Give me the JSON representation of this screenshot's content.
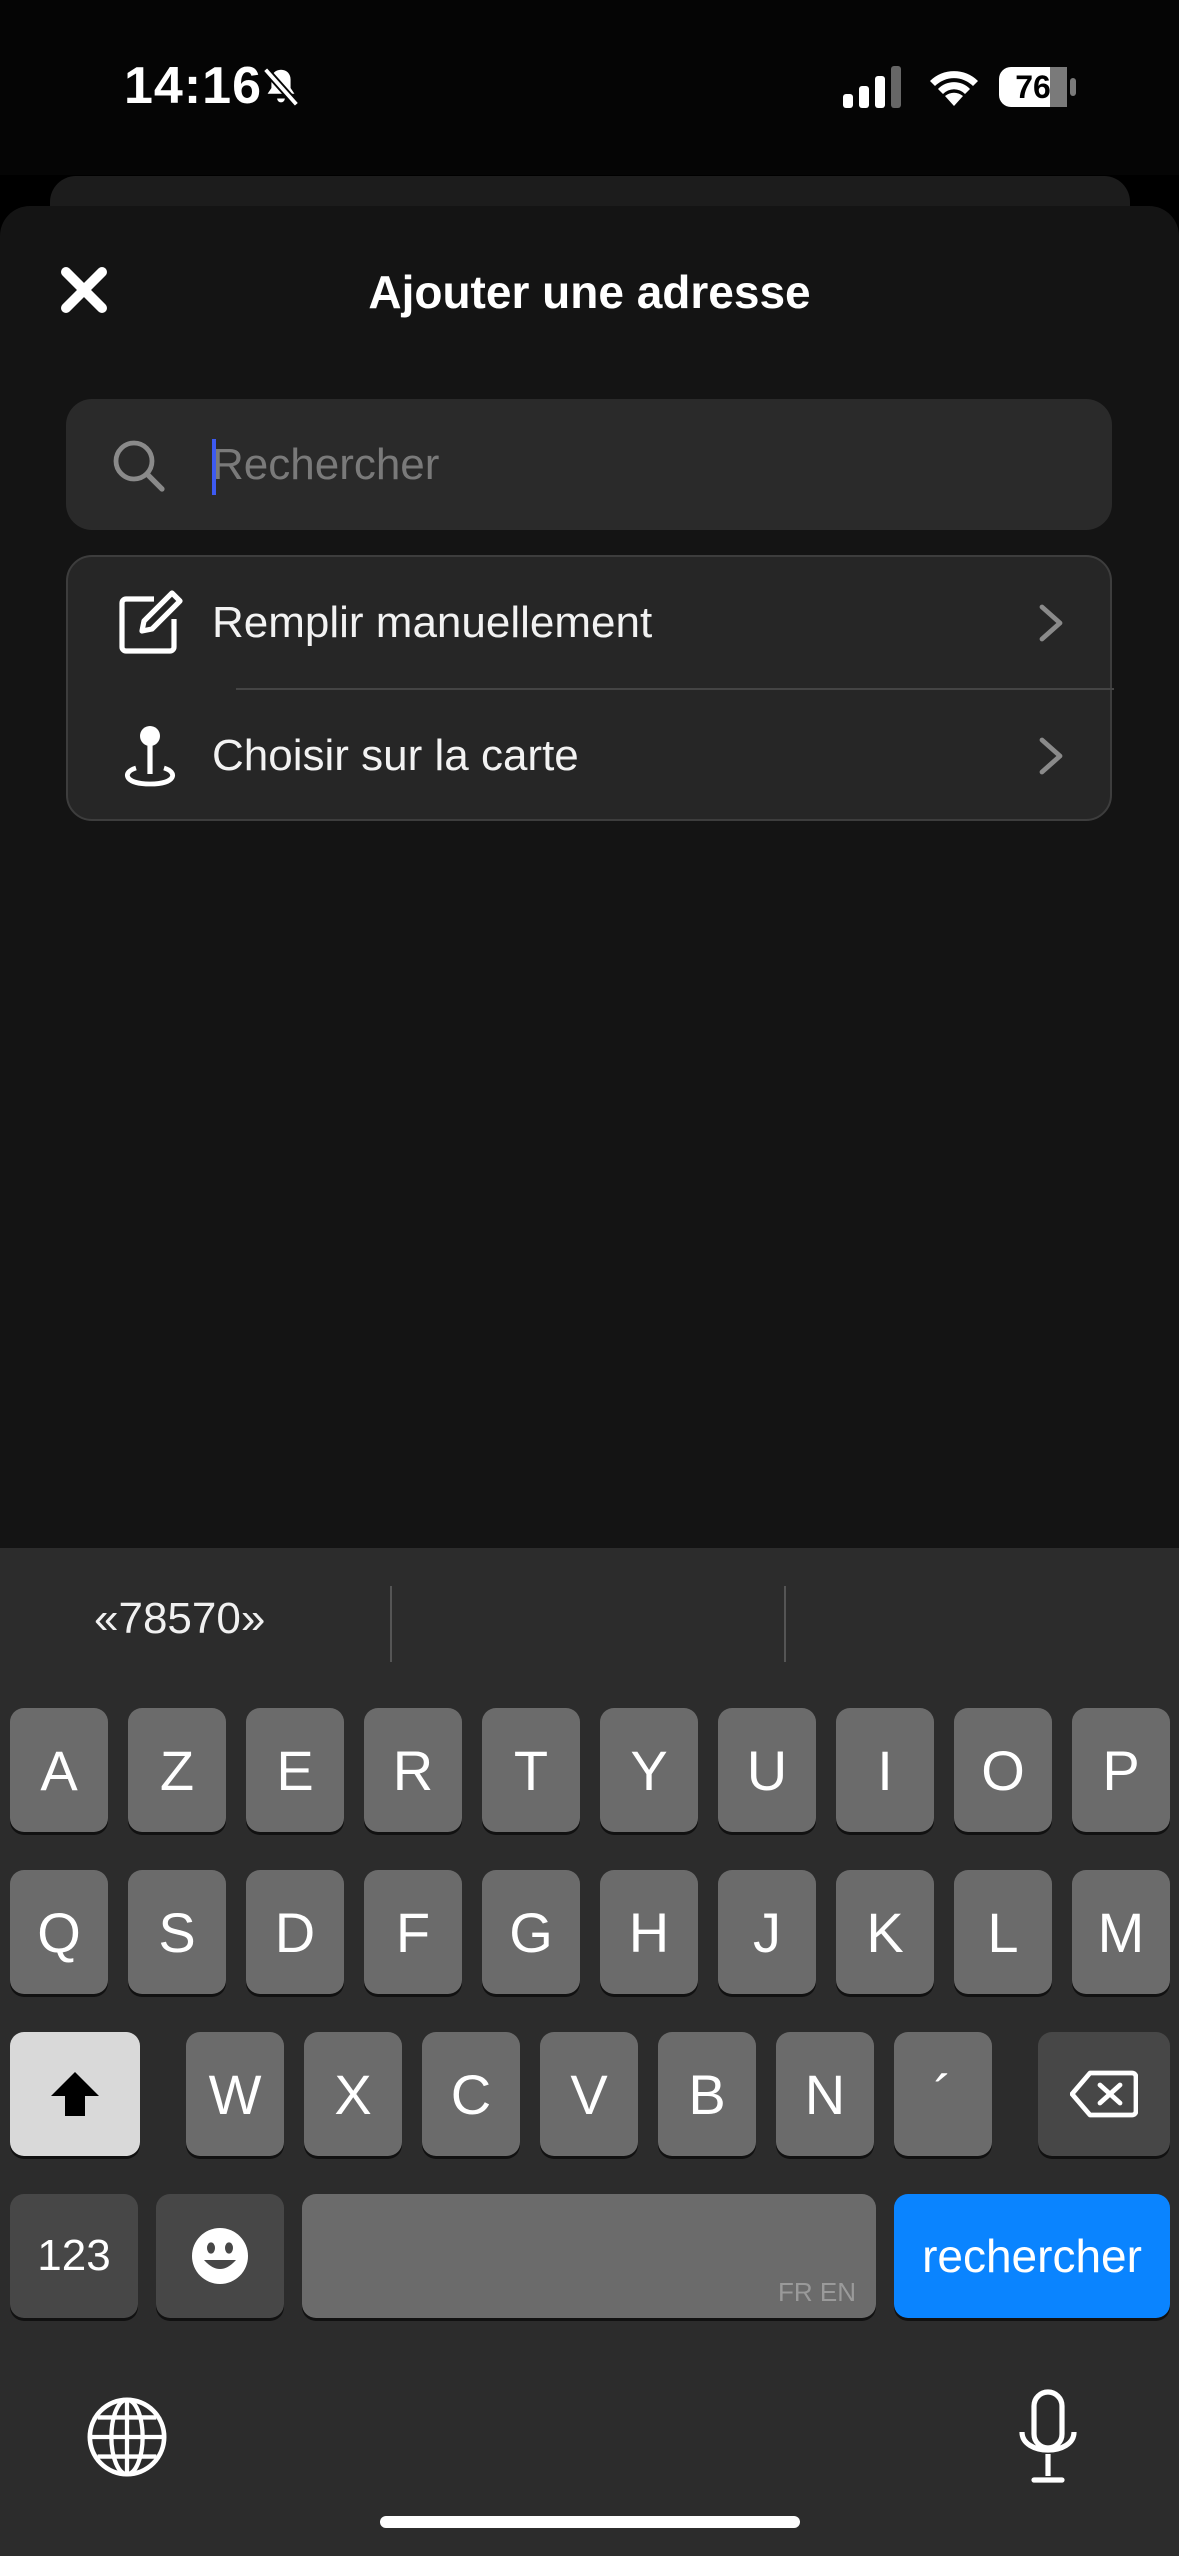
{
  "status_bar": {
    "time": "14:16",
    "battery": "76"
  },
  "sheet": {
    "title": "Ajouter une adresse",
    "search": {
      "placeholder": "Rechercher",
      "value": ""
    },
    "options": [
      {
        "label": "Remplir manuellement",
        "icon": "edit-icon"
      },
      {
        "label": "Choisir sur la carte",
        "icon": "map-pin-icon"
      }
    ]
  },
  "keyboard": {
    "predictions": [
      "«78570»",
      "",
      ""
    ],
    "row1": [
      "A",
      "Z",
      "E",
      "R",
      "T",
      "Y",
      "U",
      "I",
      "O",
      "P"
    ],
    "row2": [
      "Q",
      "S",
      "D",
      "F",
      "G",
      "H",
      "J",
      "K",
      "L",
      "M"
    ],
    "row3": [
      "W",
      "X",
      "C",
      "V",
      "B",
      "N",
      "´"
    ],
    "numbers_label": "123",
    "space_lang": "FR EN",
    "return_label": "rechercher"
  },
  "colors": {
    "accent": "#0a84ff",
    "caret": "#3d5af1",
    "sheet_bg": "#141414",
    "keyboard_bg": "#2c2c2c"
  }
}
